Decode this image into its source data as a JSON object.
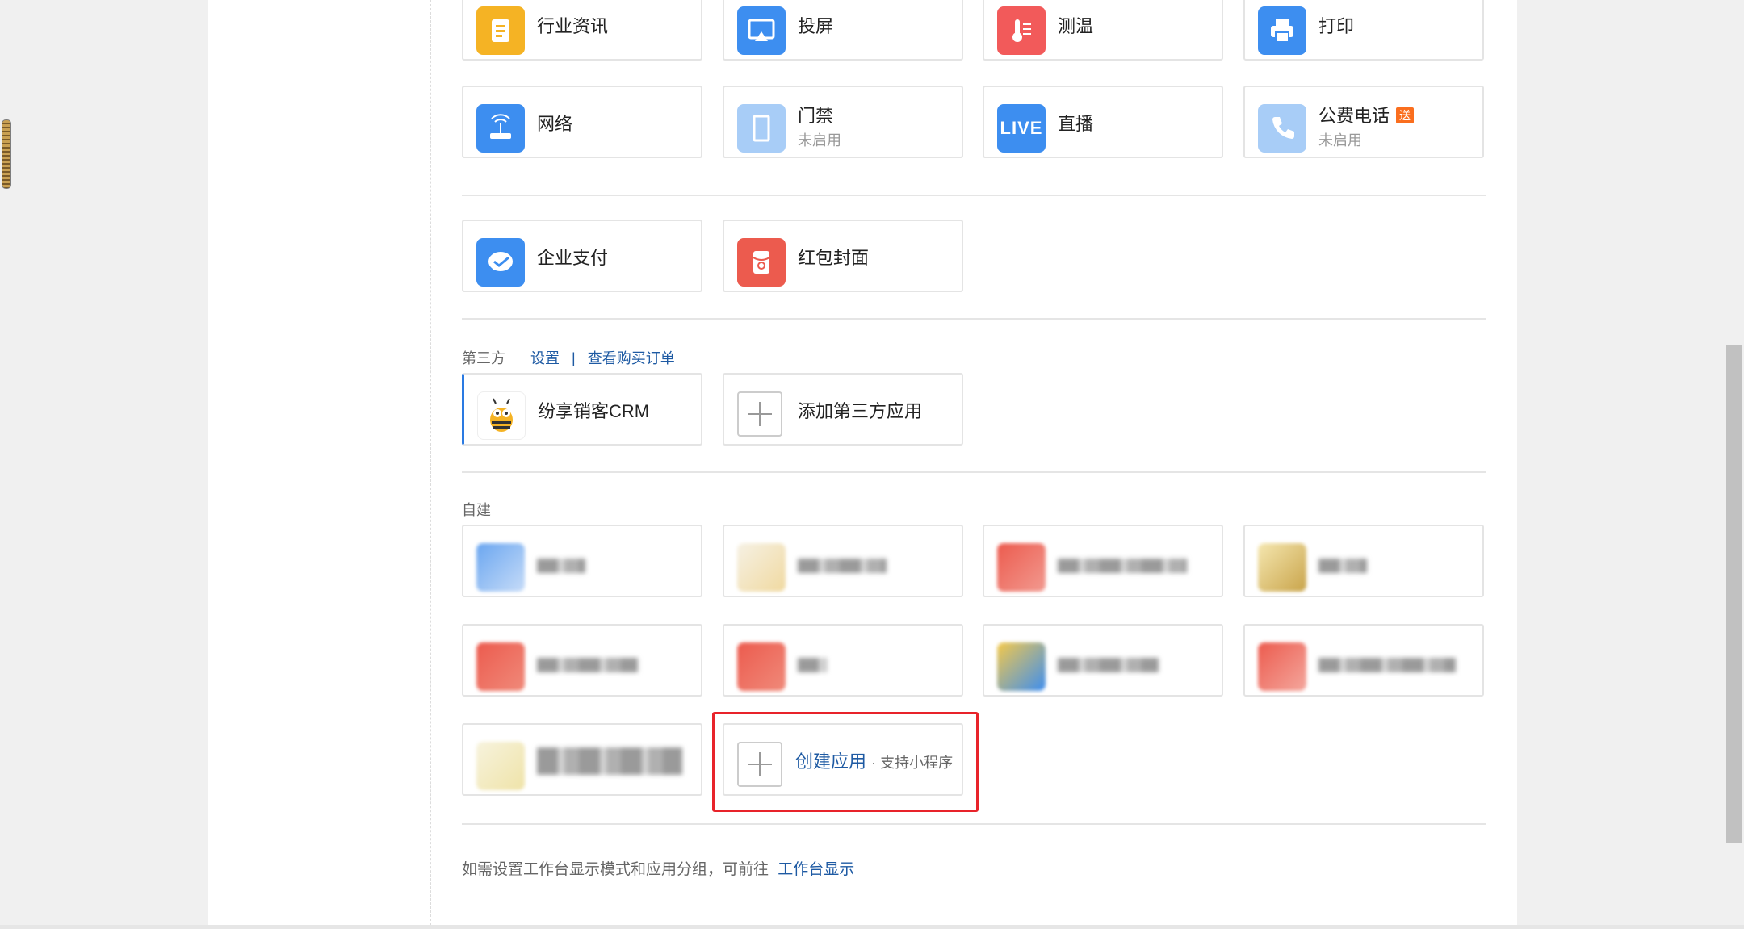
{
  "apps_row1": [
    {
      "name": "行业资讯",
      "icon": "news-icon",
      "color": "#f5b324"
    },
    {
      "name": "投屏",
      "icon": "screen-cast-icon",
      "color": "#3d8ef0"
    },
    {
      "name": "测温",
      "icon": "thermometer-icon",
      "color": "#f25a5a"
    },
    {
      "name": "打印",
      "icon": "printer-icon",
      "color": "#3d8ef0"
    }
  ],
  "apps_row2": [
    {
      "name": "网络",
      "icon": "router-icon",
      "color": "#3d8ef0"
    },
    {
      "name": "门禁",
      "status": "未启用",
      "icon": "door-icon",
      "color": "#a8cdf7"
    },
    {
      "name": "直播",
      "icon": "live-icon",
      "icon_text": "LIVE",
      "color": "#3d8ef0"
    },
    {
      "name": "公费电话",
      "status": "未启用",
      "badge": "送",
      "icon": "phone-icon",
      "color": "#a8cdf7"
    }
  ],
  "apps_row3": [
    {
      "name": "企业支付",
      "icon": "payment-icon",
      "color": "#3d8ef0"
    },
    {
      "name": "红包封面",
      "icon": "red-packet-icon",
      "color": "#ec5b4e"
    }
  ],
  "third_party": {
    "label": "第三方",
    "settings_link": "设置",
    "separator": "|",
    "orders_link": "查看购买订单",
    "apps": [
      {
        "name": "纷享销客CRM",
        "icon": "bee-mascot-icon"
      }
    ],
    "add_label": "添加第三方应用"
  },
  "custom": {
    "label": "自建",
    "create_label": "创建应用",
    "create_hint": "· 支持小程序"
  },
  "footer": {
    "text": "如需设置工作台显示模式和应用分组，可前往",
    "link": "工作台显示"
  }
}
